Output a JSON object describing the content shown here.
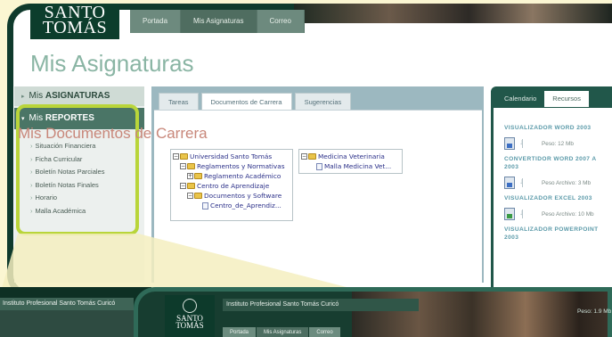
{
  "header": {
    "logo_line1": "SANTO",
    "logo_line2": "TOMÁS",
    "nav": [
      "Portada",
      "Mis Asignaturas",
      "Correo"
    ],
    "nav_active": 1
  },
  "page_title": "Mis Asignaturas",
  "sidebar": {
    "section1_prefix": "Mis ",
    "section1_bold": "ASIGNATURAS",
    "section2_prefix": "Mis ",
    "section2_bold": "REPORTES",
    "items": [
      "Situación Financiera",
      "Ficha Curricular",
      "Boletín Notas Parciales",
      "Boletín Notas Finales",
      "Horario",
      "Malla Académica"
    ]
  },
  "center": {
    "tabs": [
      "Tareas",
      "Documentos de Carrera",
      "Sugerencias"
    ],
    "active_tab": 1,
    "docs_title": "Mis Documentos de Carrera",
    "tree_left": [
      {
        "label": "Universidad Santo Tomás",
        "kind": "folder"
      },
      {
        "label": "Reglamentos y Normativas",
        "kind": "folder"
      },
      {
        "label": "Reglamento Académico",
        "kind": "folder"
      },
      {
        "label": "Centro de Aprendizaje",
        "kind": "folder"
      },
      {
        "label": "Documentos y Software",
        "kind": "folder"
      },
      {
        "label": "Centro_de_Aprendiz...",
        "kind": "file"
      }
    ],
    "tree_right": [
      {
        "label": "Medicina Veterinaria",
        "kind": "folder"
      },
      {
        "label": "Malla Medicina Vet...",
        "kind": "file"
      }
    ]
  },
  "right_panel": {
    "tabs": [
      "Calendario",
      "Recursos"
    ],
    "active_tab": 1,
    "items": [
      {
        "title": "VISUALIZADOR WORD 2003",
        "size": "Peso: 12 Mb",
        "icon": "word-doc-icon"
      },
      {
        "title": "CONVERTIDOR WORD 2007 A 2003",
        "size": "Peso Archivo: 3 Mb",
        "icon": "word-doc-icon"
      },
      {
        "title": "VISUALIZADOR EXCEL 2003",
        "size": "Peso Archivo: 10 Mb",
        "icon": "excel-doc-icon"
      },
      {
        "title": "VISUALIZADOR POWERPOINT 2003",
        "size": "",
        "icon": "ppt-doc-icon"
      }
    ],
    "overflow_text": "Peso: 1.9 Mb"
  },
  "bottom": {
    "left_caption": "Instituto Profesional Santo Tomás Curicó",
    "main_caption": "Instituto Profesional Santo Tomás Curicó",
    "logo_line1": "SANTO",
    "logo_line2": "TOMÁS",
    "nav": [
      "Portada",
      "Mis Asignaturas",
      "Correo"
    ],
    "nav_active": 1
  },
  "colors": {
    "brand_green": "#0f3a2c",
    "highlight": "#b9d53a",
    "title_green": "#8ab5a4",
    "docs_title": "#c8877a"
  }
}
